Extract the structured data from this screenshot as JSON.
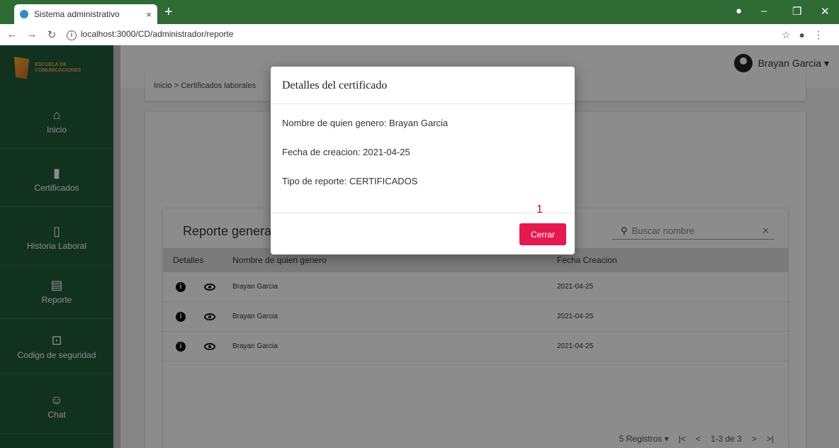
{
  "browser": {
    "tab_title": "Sistema administrativo",
    "tab_close": "×",
    "new_tab": "+",
    "url": "localhost:3000/CD/administrador/reporte",
    "controls": [
      "–",
      "❐",
      "✕"
    ]
  },
  "brand": {
    "logo_text": "ESCUELA DE COMUNICACIONES"
  },
  "sidebar": {
    "items": [
      {
        "label": "Inicio",
        "icon": "home-icon"
      },
      {
        "label": "Certificados",
        "icon": "certificate-icon"
      },
      {
        "label": "Historia Laboral",
        "icon": "book-icon"
      },
      {
        "label": "Reporte",
        "icon": "report-icon"
      },
      {
        "label": "Codigo de seguridad",
        "icon": "lock-icon"
      },
      {
        "label": "Chat",
        "icon": "chat-icon"
      }
    ]
  },
  "header": {
    "user": "Brayan Garcia"
  },
  "breadcrumb": "Inicio > Certificados laborales",
  "report": {
    "title": "Reporte generad",
    "search_placeholder": "Buscar nombre",
    "columns": [
      "Detalles",
      "Nombre de quien genero",
      "Fecha Creacion"
    ],
    "rows": [
      {
        "name": "Brayan Garcia",
        "date": "2021-04-25"
      },
      {
        "name": "Brayan Garcia",
        "date": "2021-04-25"
      },
      {
        "name": "Brayan Garcia",
        "date": "2021-04-25"
      }
    ],
    "pager": {
      "per_page": "5 Registros",
      "range": "1-3 de 3"
    }
  },
  "modal": {
    "title": "Detalles del certificado",
    "creator": "Nombre de quien genero:  Brayan Garcia",
    "created": "Fecha de creacion:  2021-04-25",
    "type": "Tipo de reporte:  CERTIFICADOS",
    "badge": "1",
    "close_label": "Cerrar"
  },
  "colors": {
    "sidebar": "#1f5b3a",
    "tabbar": "#2f6b34",
    "accent": "#e6194f"
  }
}
